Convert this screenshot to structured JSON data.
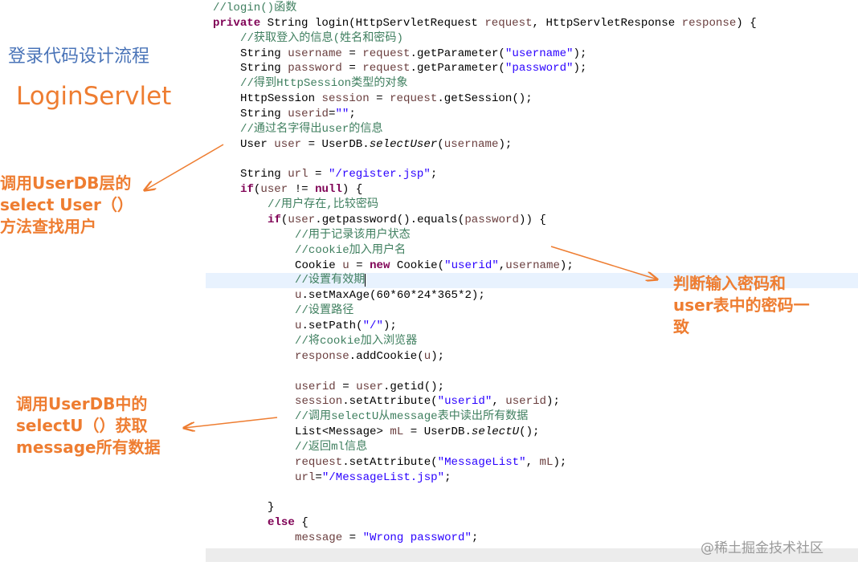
{
  "heading": "登录代码设计流程",
  "servlet_name": "LoginServlet",
  "annotations": {
    "select_user": [
      "调用UserDB层的",
      "select User（）",
      "方法查找用户"
    ],
    "password_check": [
      "判断输入密码和",
      "user表中的密码一",
      "致"
    ],
    "select_u": [
      "调用UserDB中的",
      "selectU（）获取",
      "message所有数据"
    ]
  },
  "accent_color": "#ee7d31",
  "highlighted_line": 18,
  "watermark": "@稀土掘金技术社区",
  "code_lines": [
    {
      "i": 0,
      "t": [
        [
          "c",
          "//login()函数"
        ]
      ]
    },
    {
      "i": 0,
      "t": [
        [
          "k",
          "private"
        ],
        [
          "p",
          " String login(HttpServletRequest "
        ],
        [
          "v",
          "request"
        ],
        [
          "p",
          ", HttpServletResponse "
        ],
        [
          "v",
          "response"
        ],
        [
          "p",
          ") {"
        ]
      ]
    },
    {
      "i": 1,
      "t": [
        [
          "c",
          "//获取登入的信息(姓名和密码)"
        ]
      ]
    },
    {
      "i": 1,
      "t": [
        [
          "p",
          "String "
        ],
        [
          "v",
          "username"
        ],
        [
          "p",
          " = "
        ],
        [
          "v",
          "request"
        ],
        [
          "p",
          ".getParameter("
        ],
        [
          "s",
          "\"username\""
        ],
        [
          "p",
          ");"
        ]
      ]
    },
    {
      "i": 1,
      "t": [
        [
          "p",
          "String "
        ],
        [
          "v",
          "password"
        ],
        [
          "p",
          " = "
        ],
        [
          "v",
          "request"
        ],
        [
          "p",
          ".getParameter("
        ],
        [
          "s",
          "\"password\""
        ],
        [
          "p",
          ");"
        ]
      ]
    },
    {
      "i": 1,
      "t": [
        [
          "c",
          "//得到HttpSession类型的对象"
        ]
      ]
    },
    {
      "i": 1,
      "t": [
        [
          "p",
          "HttpSession "
        ],
        [
          "v",
          "session"
        ],
        [
          "p",
          " = "
        ],
        [
          "v",
          "request"
        ],
        [
          "p",
          ".getSession();"
        ]
      ]
    },
    {
      "i": 1,
      "t": [
        [
          "p",
          "String "
        ],
        [
          "v",
          "userid"
        ],
        [
          "p",
          "="
        ],
        [
          "s",
          "\"\""
        ],
        [
          "p",
          ";"
        ]
      ]
    },
    {
      "i": 1,
      "t": [
        [
          "c",
          "//通过名字得出user的信息"
        ]
      ]
    },
    {
      "i": 1,
      "t": [
        [
          "p",
          "User "
        ],
        [
          "v",
          "user"
        ],
        [
          "p",
          " = UserDB."
        ],
        [
          "f",
          "selectUser"
        ],
        [
          "p",
          "("
        ],
        [
          "v",
          "username"
        ],
        [
          "p",
          ");"
        ]
      ]
    },
    {
      "i": 0,
      "t": []
    },
    {
      "i": 1,
      "t": [
        [
          "p",
          "String "
        ],
        [
          "v",
          "url"
        ],
        [
          "p",
          " = "
        ],
        [
          "s",
          "\"/register.jsp\""
        ],
        [
          "p",
          ";"
        ]
      ]
    },
    {
      "i": 1,
      "t": [
        [
          "k",
          "if"
        ],
        [
          "p",
          "("
        ],
        [
          "v",
          "user"
        ],
        [
          "p",
          " != "
        ],
        [
          "k",
          "null"
        ],
        [
          "p",
          ") {"
        ]
      ]
    },
    {
      "i": 2,
      "t": [
        [
          "c",
          "//用户存在,比较密码"
        ]
      ]
    },
    {
      "i": 2,
      "t": [
        [
          "k",
          "if"
        ],
        [
          "p",
          "("
        ],
        [
          "v",
          "user"
        ],
        [
          "p",
          ".getpassword().equals("
        ],
        [
          "v",
          "password"
        ],
        [
          "p",
          ")) {"
        ]
      ]
    },
    {
      "i": 3,
      "t": [
        [
          "c",
          "//用于记录该用户状态"
        ]
      ]
    },
    {
      "i": 3,
      "t": [
        [
          "c",
          "//cookie加入用户名"
        ]
      ]
    },
    {
      "i": 3,
      "t": [
        [
          "p",
          "Cookie "
        ],
        [
          "v",
          "u"
        ],
        [
          "p",
          " = "
        ],
        [
          "k",
          "new"
        ],
        [
          "p",
          " Cookie("
        ],
        [
          "s",
          "\"userid\""
        ],
        [
          "p",
          ","
        ],
        [
          "v",
          "username"
        ],
        [
          "p",
          ");"
        ]
      ]
    },
    {
      "i": 3,
      "t": [
        [
          "c",
          "//设置有效期"
        ]
      ]
    },
    {
      "i": 3,
      "t": [
        [
          "v",
          "u"
        ],
        [
          "p",
          ".setMaxAge(60*60*24*365*2);"
        ]
      ]
    },
    {
      "i": 3,
      "t": [
        [
          "c",
          "//设置路径"
        ]
      ]
    },
    {
      "i": 3,
      "t": [
        [
          "v",
          "u"
        ],
        [
          "p",
          ".setPath("
        ],
        [
          "s",
          "\"/\""
        ],
        [
          "p",
          ");"
        ]
      ]
    },
    {
      "i": 3,
      "t": [
        [
          "c",
          "//将cookie加入浏览器"
        ]
      ]
    },
    {
      "i": 3,
      "t": [
        [
          "v",
          "response"
        ],
        [
          "p",
          ".addCookie("
        ],
        [
          "v",
          "u"
        ],
        [
          "p",
          ");"
        ]
      ]
    },
    {
      "i": 0,
      "t": []
    },
    {
      "i": 3,
      "t": [
        [
          "v",
          "userid"
        ],
        [
          "p",
          " = "
        ],
        [
          "v",
          "user"
        ],
        [
          "p",
          ".getid();"
        ]
      ]
    },
    {
      "i": 3,
      "t": [
        [
          "v",
          "session"
        ],
        [
          "p",
          ".setAttribute("
        ],
        [
          "s",
          "\"userid\""
        ],
        [
          "p",
          ", "
        ],
        [
          "v",
          "userid"
        ],
        [
          "p",
          ");"
        ]
      ]
    },
    {
      "i": 3,
      "t": [
        [
          "c",
          "//调用selectU从message表中读出所有数据"
        ]
      ]
    },
    {
      "i": 3,
      "t": [
        [
          "p",
          "List<Message> "
        ],
        [
          "v",
          "mL"
        ],
        [
          "p",
          " = UserDB."
        ],
        [
          "f",
          "selectU"
        ],
        [
          "p",
          "();"
        ]
      ]
    },
    {
      "i": 3,
      "t": [
        [
          "c",
          "//返回ml信息"
        ]
      ]
    },
    {
      "i": 3,
      "t": [
        [
          "v",
          "request"
        ],
        [
          "p",
          ".setAttribute("
        ],
        [
          "s",
          "\"MessageList\""
        ],
        [
          "p",
          ", "
        ],
        [
          "v",
          "mL"
        ],
        [
          "p",
          ");"
        ]
      ]
    },
    {
      "i": 3,
      "t": [
        [
          "v",
          "url"
        ],
        [
          "p",
          "="
        ],
        [
          "s",
          "\"/MessageList.jsp\""
        ],
        [
          "p",
          ";"
        ]
      ]
    },
    {
      "i": 0,
      "t": []
    },
    {
      "i": 2,
      "t": [
        [
          "p",
          "}"
        ]
      ]
    },
    {
      "i": 2,
      "t": [
        [
          "k",
          "else"
        ],
        [
          "p",
          " {"
        ]
      ]
    },
    {
      "i": 3,
      "t": [
        [
          "v",
          "message"
        ],
        [
          "p",
          " = "
        ],
        [
          "s",
          "\"Wrong password\""
        ],
        [
          "p",
          ";"
        ]
      ]
    }
  ]
}
